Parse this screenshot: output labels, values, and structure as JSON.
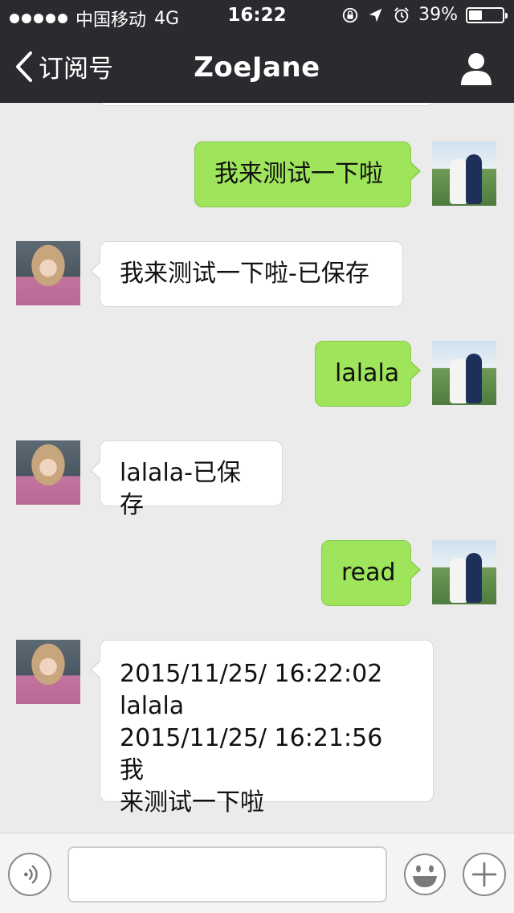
{
  "status_bar": {
    "carrier": "中国移动",
    "network": "4G",
    "time": "16:22",
    "battery_percent": "39%",
    "battery_level": 0.39
  },
  "nav": {
    "back_label": "订阅号",
    "title": "ZoeJane",
    "profile_icon": "person-icon"
  },
  "messages": [
    {
      "side": "right",
      "text": "我来测试一下啦"
    },
    {
      "side": "left",
      "text": "我来测试一下啦-已保存"
    },
    {
      "side": "right",
      "text": "lalala"
    },
    {
      "side": "left",
      "text": "lalala-已保存"
    },
    {
      "side": "right",
      "text": "read"
    },
    {
      "side": "left",
      "text": "2015/11/25/ 16:22:02\nlalala\n2015/11/25/ 16:21:56 我\n来测试一下啦"
    }
  ],
  "input_bar": {
    "message_value": "",
    "voice_icon": "voice-icon",
    "emoji_icon": "emoji-icon",
    "plus_icon": "plus-icon"
  },
  "colors": {
    "nav_bg": "#2b2b2f",
    "chat_bg": "#ebebeb",
    "outgoing_bubble": "#9fe55b",
    "incoming_bubble": "#ffffff"
  }
}
